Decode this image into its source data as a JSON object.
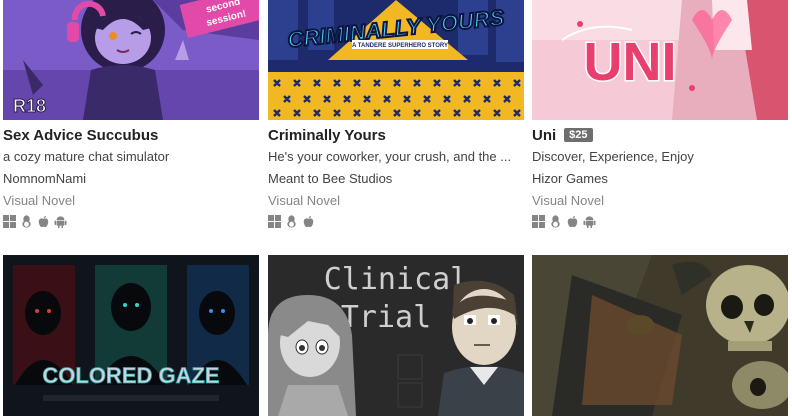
{
  "games": [
    {
      "title": "Sex Advice Succubus",
      "price": "",
      "short_text": "a cozy mature chat simulator",
      "author": "NomnomNami",
      "genre": "Visual Novel",
      "platforms": [
        "windows-icon",
        "linux-icon",
        "apple-icon",
        "android-icon"
      ],
      "cover_text": {
        "badge": "R18",
        "ribbon_line1": "second",
        "ribbon_line2": "session!"
      },
      "colors": {
        "bg": "#7a5bc7",
        "accent": "#e14aa8"
      }
    },
    {
      "title": "Criminally Yours",
      "price": "",
      "short_text": "He's your coworker, your crush, and the ...",
      "author": "Meant to Bee Studios",
      "genre": "Visual Novel",
      "platforms": [
        "windows-icon",
        "linux-icon",
        "apple-icon"
      ],
      "cover_text": {
        "logo": "CRIMINALLY YOURS",
        "tagline": "A TANDERE SUPERHERO STORY"
      },
      "colors": {
        "bg": "#1d2a6b",
        "accent": "#f1b823"
      }
    },
    {
      "title": "Uni",
      "price": "$25",
      "short_text": "Discover, Experience, Enjoy",
      "author": "Hizor Games",
      "genre": "Visual Novel",
      "platforms": [
        "windows-icon",
        "linux-icon",
        "apple-icon",
        "android-icon"
      ],
      "cover_text": {
        "logo": "UNI"
      },
      "colors": {
        "bg": "#f5c9d6",
        "accent": "#e83f6f"
      }
    },
    {
      "title": "",
      "cover_text": {
        "logo": "COLORED GAZE"
      },
      "colors": {
        "bg": "#10151c",
        "accent": "#2fa3a8"
      }
    },
    {
      "title": "",
      "cover_text": {
        "line1": "Clinical",
        "line2": "Trial"
      },
      "colors": {
        "bg": "#2a2a2a",
        "accent": "#cfcfcf"
      }
    },
    {
      "title": "",
      "cover_text": {},
      "colors": {
        "bg": "#3f3a2a",
        "accent": "#b7b28a"
      }
    }
  ]
}
